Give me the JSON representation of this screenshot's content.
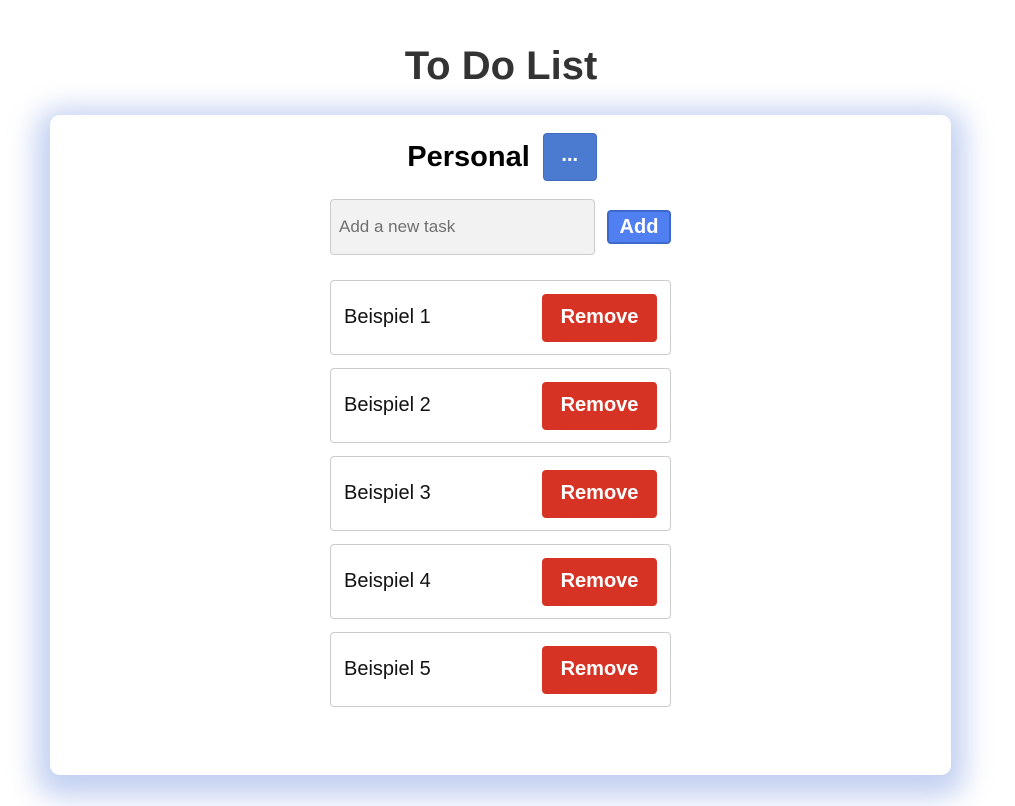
{
  "page": {
    "title": "To Do List"
  },
  "list": {
    "name": "Personal",
    "menu_label": "..."
  },
  "add_task": {
    "placeholder": "Add a new task",
    "value": "",
    "button_label": "Add"
  },
  "tasks": [
    {
      "label": "Beispiel 1",
      "remove_label": "Remove"
    },
    {
      "label": "Beispiel 2",
      "remove_label": "Remove"
    },
    {
      "label": "Beispiel 3",
      "remove_label": "Remove"
    },
    {
      "label": "Beispiel 4",
      "remove_label": "Remove"
    },
    {
      "label": "Beispiel 5",
      "remove_label": "Remove"
    }
  ],
  "colors": {
    "menu_button": "#4a7bd0",
    "add_button": "#4f7ff0",
    "remove_button": "#d63324",
    "card_shadow": "#7896e1"
  }
}
